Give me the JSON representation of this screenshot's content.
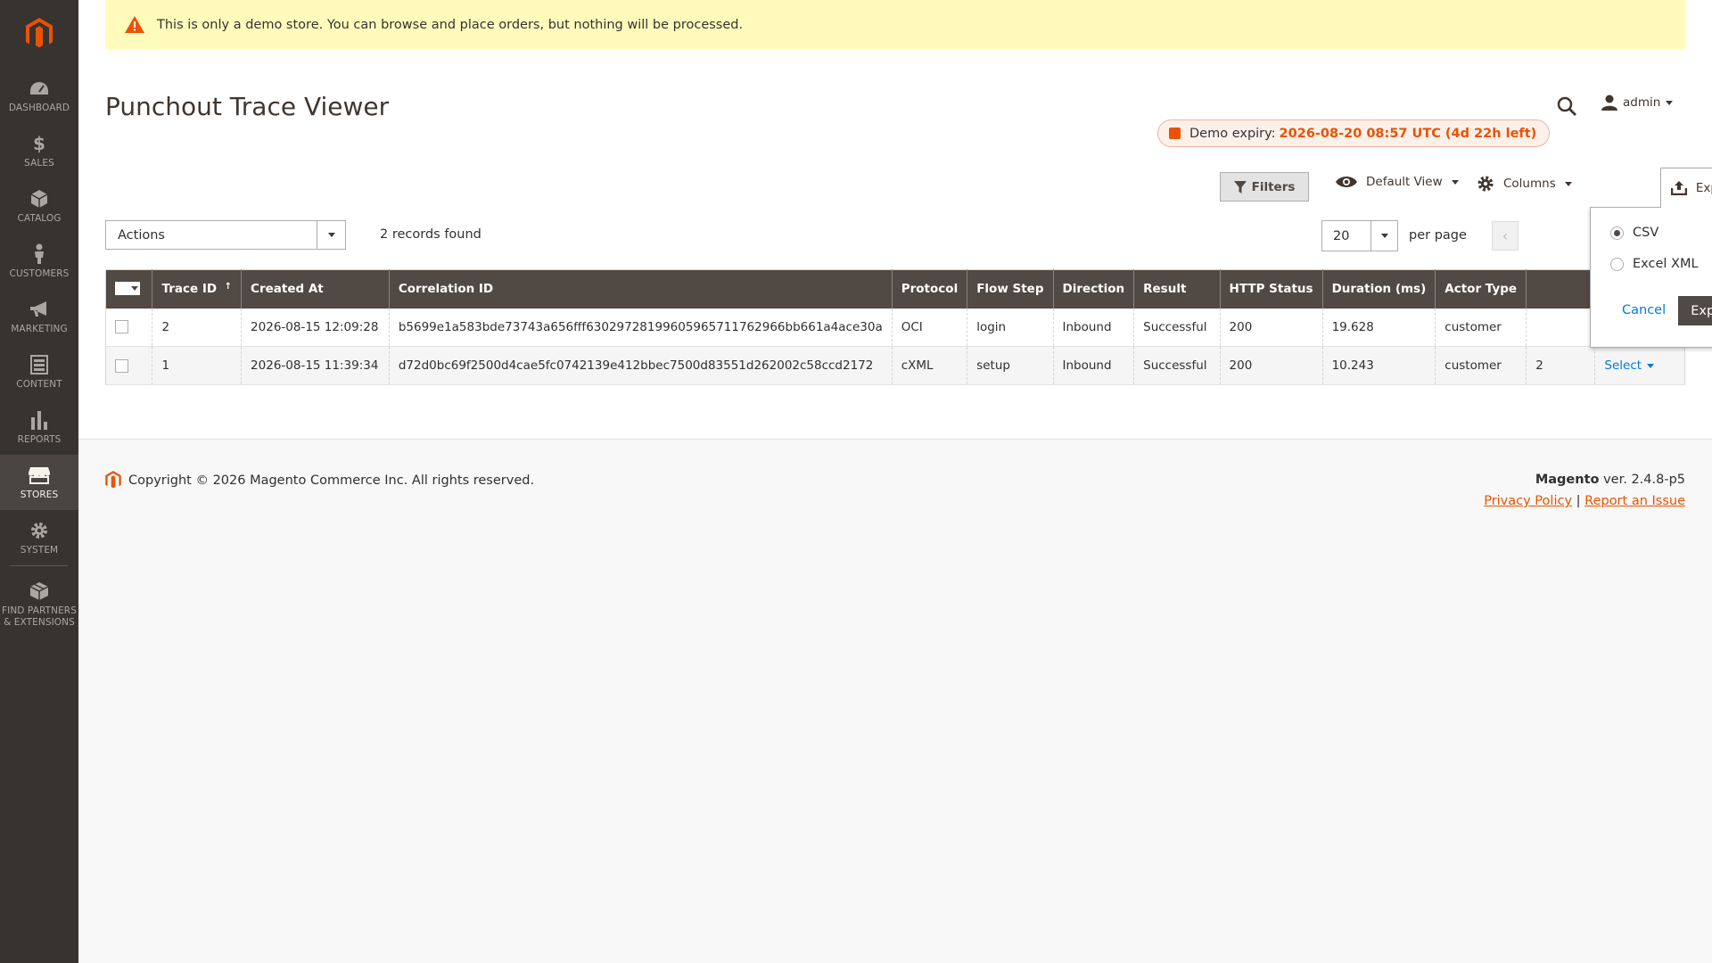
{
  "sidebar": {
    "logo_icon": "magento-logo-icon",
    "items": [
      {
        "label": "Dashboard",
        "icon": "dashboard-icon"
      },
      {
        "label": "Sales",
        "icon": "dollar-icon"
      },
      {
        "label": "Catalog",
        "icon": "cube-icon"
      },
      {
        "label": "Customers",
        "icon": "person-icon"
      },
      {
        "label": "Marketing",
        "icon": "megaphone-icon"
      },
      {
        "label": "Content",
        "icon": "layout-icon"
      },
      {
        "label": "Reports",
        "icon": "bar-chart-icon"
      },
      {
        "label": "Stores",
        "icon": "storefront-icon"
      },
      {
        "label": "System",
        "icon": "gear-icon"
      },
      {
        "label": "Find Partners & Extensions",
        "icon": "box-icon"
      }
    ],
    "active_index": 7
  },
  "notice": {
    "text": "This is only a demo store. You can browse and place orders, but nothing will be processed."
  },
  "header": {
    "title": "Punchout Trace Viewer",
    "user": "admin",
    "expiry_label": "Demo expiry:",
    "expiry_value": "2026-08-20 08:57 UTC (4d 22h left)"
  },
  "toolbar": {
    "filters": "Filters",
    "default_view": "Default View",
    "columns": "Columns",
    "export": "Export",
    "actions": "Actions",
    "records_found": "2 records found",
    "per_page_value": "20",
    "per_page_label": "per page"
  },
  "export_panel": {
    "options": [
      "CSV",
      "Excel XML"
    ],
    "selected": "CSV",
    "cancel": "Cancel",
    "submit": "Export"
  },
  "grid": {
    "columns": [
      "Trace ID",
      "Created At",
      "Correlation ID",
      "Protocol",
      "Flow Step",
      "Direction",
      "Result",
      "HTTP Status",
      "Duration (ms)",
      "Actor Type"
    ],
    "sort_arrow": "↑",
    "rows": [
      {
        "trace_id": "2",
        "created_at": "2026-08-15 12:09:28",
        "correlation_id": "b5699e1a583bde73743a656fff63029728199605965711762966bb661a4ace30a",
        "protocol": "OCI",
        "flow_step": "login",
        "direction": "Inbound",
        "result": "Successful",
        "http_status": "200",
        "duration": "19.628",
        "actor_type": "customer",
        "extra": "",
        "action": ""
      },
      {
        "trace_id": "1",
        "created_at": "2026-08-15 11:39:34",
        "correlation_id": "d72d0bc69f2500d4cae5fc0742139e412bbec7500d83551d262002c58ccd2172",
        "protocol": "cXML",
        "flow_step": "setup",
        "direction": "Inbound",
        "result": "Successful",
        "http_status": "200",
        "duration": "10.243",
        "actor_type": "customer",
        "extra": "2",
        "action": "Select"
      }
    ]
  },
  "footer": {
    "copyright": "Copyright © 2026 Magento Commerce Inc. All rights reserved.",
    "brand": "Magento",
    "version": " ver. 2.4.8-p5",
    "privacy": "Privacy Policy",
    "separator": "|",
    "report": "Report an Issue"
  },
  "colors": {
    "sidebar_bg": "#373330",
    "accent": "#eb5202",
    "grid_header": "#514943",
    "link": "#007bdb"
  }
}
